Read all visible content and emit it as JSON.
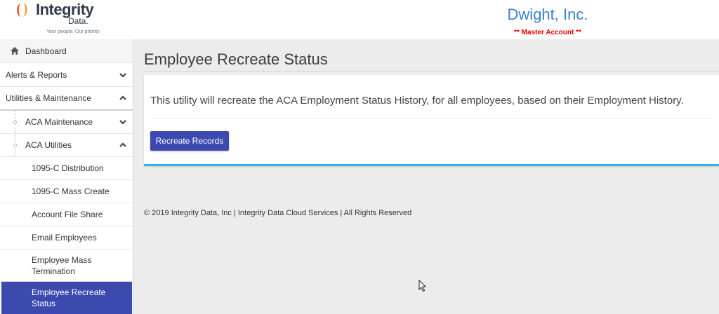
{
  "header": {
    "logo_name": "Integrity",
    "logo_sub": "Data.",
    "logo_tagline": "Your people. Our priority.",
    "company_name": "Dwight, Inc.",
    "account_note": "** Master Account **"
  },
  "sidebar": {
    "dashboard": "Dashboard",
    "alerts_reports": "Alerts & Reports",
    "utilities_maintenance": "Utilities & Maintenance",
    "aca_maintenance": "ACA Maintenance",
    "aca_utilities": "ACA Utilities",
    "leaves": [
      "1095-C Distribution",
      "1095-C Mass Create",
      "Account File Share",
      "Email Employees",
      "Employee Mass Termination",
      "Employee Recreate Status"
    ]
  },
  "main": {
    "title": "Employee Recreate Status",
    "description": "This utility will recreate the ACA Employment Status History, for all employees, based on their Employment History.",
    "button_label": "Recreate Records",
    "footer": "© 2019 Integrity Data, Inc | Integrity Data Cloud Services | All Rights Reserved"
  },
  "colors": {
    "accent": "#3c4ab0",
    "company": "#3a80c9",
    "warning": "#e60000",
    "card_border": "#3aaee0"
  }
}
